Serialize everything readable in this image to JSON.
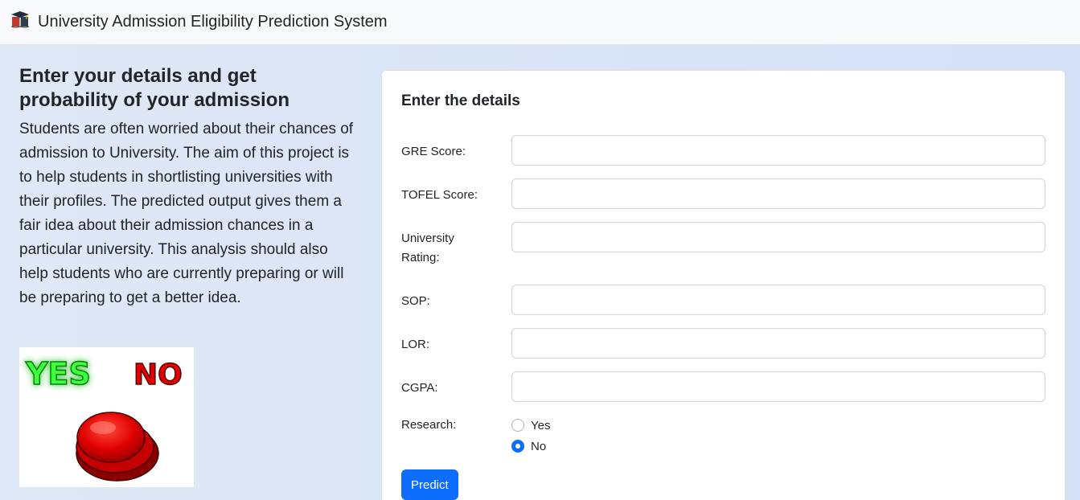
{
  "navbar": {
    "title": "University Admission Eligibility Prediction System",
    "logo_icon": "graduation-book-icon"
  },
  "intro": {
    "heading": "Enter your details and get probability of your admission",
    "description": "Students are often worried about their chances of admission to University. The aim of this project is to help students in shortlisting universities with their profiles. The predicted output gives them a fair idea about their admission chances in a particular university. This analysis should also help students who are currently preparing or will be preparing to get a better idea.",
    "image": {
      "yes_text": "YES",
      "no_text": "NO",
      "button_icon": "red-push-button-icon"
    }
  },
  "form": {
    "title": "Enter the details",
    "fields": [
      {
        "label": "GRE Score:",
        "value": "",
        "placeholder": ""
      },
      {
        "label": "TOFEL Score:",
        "value": "",
        "placeholder": ""
      },
      {
        "label": "University Rating:",
        "value": "",
        "placeholder": ""
      },
      {
        "label": "SOP:",
        "value": "",
        "placeholder": ""
      },
      {
        "label": "LOR:",
        "value": "",
        "placeholder": ""
      },
      {
        "label": "CGPA:",
        "value": "",
        "placeholder": ""
      }
    ],
    "research": {
      "label": "Research:",
      "options": [
        {
          "label": "Yes",
          "checked": false
        },
        {
          "label": "No",
          "checked": true
        }
      ]
    },
    "submit_label": "Predict"
  },
  "colors": {
    "primary": "#0d6efd",
    "navbar_bg": "#f8f9fa",
    "page_bg": "#dbe5f6"
  }
}
